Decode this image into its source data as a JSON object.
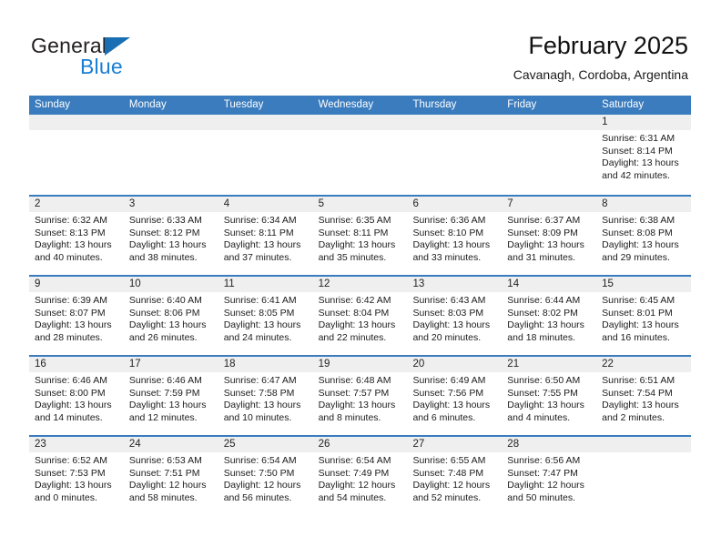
{
  "brand": {
    "word_one": "General",
    "word_two": "Blue",
    "triangle_icon": "triangle-icon",
    "accent_color": "#1a7fd4"
  },
  "header": {
    "title": "February 2025",
    "subtitle": "Cavanagh, Cordoba, Argentina"
  },
  "theme": {
    "header_blue": "#3a7cbe",
    "day_band_gray": "#efefef"
  },
  "weekday_headers": [
    "Sunday",
    "Monday",
    "Tuesday",
    "Wednesday",
    "Thursday",
    "Friday",
    "Saturday"
  ],
  "labels": {
    "sunrise": "Sunrise:",
    "sunset": "Sunset:",
    "daylight": "Daylight:"
  },
  "weeks": [
    [
      {
        "day": "",
        "l1": "",
        "l2": "",
        "l3": "",
        "l4": ""
      },
      {
        "day": "",
        "l1": "",
        "l2": "",
        "l3": "",
        "l4": ""
      },
      {
        "day": "",
        "l1": "",
        "l2": "",
        "l3": "",
        "l4": ""
      },
      {
        "day": "",
        "l1": "",
        "l2": "",
        "l3": "",
        "l4": ""
      },
      {
        "day": "",
        "l1": "",
        "l2": "",
        "l3": "",
        "l4": ""
      },
      {
        "day": "",
        "l1": "",
        "l2": "",
        "l3": "",
        "l4": ""
      },
      {
        "day": "1",
        "l1": "Sunrise: 6:31 AM",
        "l2": "Sunset: 8:14 PM",
        "l3": "Daylight: 13 hours",
        "l4": "and 42 minutes."
      }
    ],
    [
      {
        "day": "2",
        "l1": "Sunrise: 6:32 AM",
        "l2": "Sunset: 8:13 PM",
        "l3": "Daylight: 13 hours",
        "l4": "and 40 minutes."
      },
      {
        "day": "3",
        "l1": "Sunrise: 6:33 AM",
        "l2": "Sunset: 8:12 PM",
        "l3": "Daylight: 13 hours",
        "l4": "and 38 minutes."
      },
      {
        "day": "4",
        "l1": "Sunrise: 6:34 AM",
        "l2": "Sunset: 8:11 PM",
        "l3": "Daylight: 13 hours",
        "l4": "and 37 minutes."
      },
      {
        "day": "5",
        "l1": "Sunrise: 6:35 AM",
        "l2": "Sunset: 8:11 PM",
        "l3": "Daylight: 13 hours",
        "l4": "and 35 minutes."
      },
      {
        "day": "6",
        "l1": "Sunrise: 6:36 AM",
        "l2": "Sunset: 8:10 PM",
        "l3": "Daylight: 13 hours",
        "l4": "and 33 minutes."
      },
      {
        "day": "7",
        "l1": "Sunrise: 6:37 AM",
        "l2": "Sunset: 8:09 PM",
        "l3": "Daylight: 13 hours",
        "l4": "and 31 minutes."
      },
      {
        "day": "8",
        "l1": "Sunrise: 6:38 AM",
        "l2": "Sunset: 8:08 PM",
        "l3": "Daylight: 13 hours",
        "l4": "and 29 minutes."
      }
    ],
    [
      {
        "day": "9",
        "l1": "Sunrise: 6:39 AM",
        "l2": "Sunset: 8:07 PM",
        "l3": "Daylight: 13 hours",
        "l4": "and 28 minutes."
      },
      {
        "day": "10",
        "l1": "Sunrise: 6:40 AM",
        "l2": "Sunset: 8:06 PM",
        "l3": "Daylight: 13 hours",
        "l4": "and 26 minutes."
      },
      {
        "day": "11",
        "l1": "Sunrise: 6:41 AM",
        "l2": "Sunset: 8:05 PM",
        "l3": "Daylight: 13 hours",
        "l4": "and 24 minutes."
      },
      {
        "day": "12",
        "l1": "Sunrise: 6:42 AM",
        "l2": "Sunset: 8:04 PM",
        "l3": "Daylight: 13 hours",
        "l4": "and 22 minutes."
      },
      {
        "day": "13",
        "l1": "Sunrise: 6:43 AM",
        "l2": "Sunset: 8:03 PM",
        "l3": "Daylight: 13 hours",
        "l4": "and 20 minutes."
      },
      {
        "day": "14",
        "l1": "Sunrise: 6:44 AM",
        "l2": "Sunset: 8:02 PM",
        "l3": "Daylight: 13 hours",
        "l4": "and 18 minutes."
      },
      {
        "day": "15",
        "l1": "Sunrise: 6:45 AM",
        "l2": "Sunset: 8:01 PM",
        "l3": "Daylight: 13 hours",
        "l4": "and 16 minutes."
      }
    ],
    [
      {
        "day": "16",
        "l1": "Sunrise: 6:46 AM",
        "l2": "Sunset: 8:00 PM",
        "l3": "Daylight: 13 hours",
        "l4": "and 14 minutes."
      },
      {
        "day": "17",
        "l1": "Sunrise: 6:46 AM",
        "l2": "Sunset: 7:59 PM",
        "l3": "Daylight: 13 hours",
        "l4": "and 12 minutes."
      },
      {
        "day": "18",
        "l1": "Sunrise: 6:47 AM",
        "l2": "Sunset: 7:58 PM",
        "l3": "Daylight: 13 hours",
        "l4": "and 10 minutes."
      },
      {
        "day": "19",
        "l1": "Sunrise: 6:48 AM",
        "l2": "Sunset: 7:57 PM",
        "l3": "Daylight: 13 hours",
        "l4": "and 8 minutes."
      },
      {
        "day": "20",
        "l1": "Sunrise: 6:49 AM",
        "l2": "Sunset: 7:56 PM",
        "l3": "Daylight: 13 hours",
        "l4": "and 6 minutes."
      },
      {
        "day": "21",
        "l1": "Sunrise: 6:50 AM",
        "l2": "Sunset: 7:55 PM",
        "l3": "Daylight: 13 hours",
        "l4": "and 4 minutes."
      },
      {
        "day": "22",
        "l1": "Sunrise: 6:51 AM",
        "l2": "Sunset: 7:54 PM",
        "l3": "Daylight: 13 hours",
        "l4": "and 2 minutes."
      }
    ],
    [
      {
        "day": "23",
        "l1": "Sunrise: 6:52 AM",
        "l2": "Sunset: 7:53 PM",
        "l3": "Daylight: 13 hours",
        "l4": "and 0 minutes."
      },
      {
        "day": "24",
        "l1": "Sunrise: 6:53 AM",
        "l2": "Sunset: 7:51 PM",
        "l3": "Daylight: 12 hours",
        "l4": "and 58 minutes."
      },
      {
        "day": "25",
        "l1": "Sunrise: 6:54 AM",
        "l2": "Sunset: 7:50 PM",
        "l3": "Daylight: 12 hours",
        "l4": "and 56 minutes."
      },
      {
        "day": "26",
        "l1": "Sunrise: 6:54 AM",
        "l2": "Sunset: 7:49 PM",
        "l3": "Daylight: 12 hours",
        "l4": "and 54 minutes."
      },
      {
        "day": "27",
        "l1": "Sunrise: 6:55 AM",
        "l2": "Sunset: 7:48 PM",
        "l3": "Daylight: 12 hours",
        "l4": "and 52 minutes."
      },
      {
        "day": "28",
        "l1": "Sunrise: 6:56 AM",
        "l2": "Sunset: 7:47 PM",
        "l3": "Daylight: 12 hours",
        "l4": "and 50 minutes."
      },
      {
        "day": "",
        "l1": "",
        "l2": "",
        "l3": "",
        "l4": ""
      }
    ]
  ]
}
